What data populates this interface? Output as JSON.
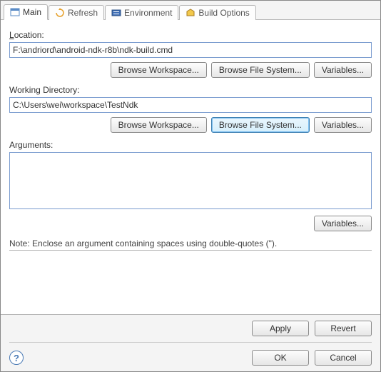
{
  "tabs": {
    "main": "Main",
    "refresh": "Refresh",
    "environment": "Environment",
    "build_options": "Build Options"
  },
  "location": {
    "label": "Location:",
    "value": "F:\\andriord\\android-ndk-r8b\\ndk-build.cmd",
    "browse_workspace": "Browse Workspace...",
    "browse_filesystem": "Browse File System...",
    "variables": "Variables..."
  },
  "working_dir": {
    "label": "Working Directory:",
    "value": "C:\\Users\\wei\\workspace\\TestNdk",
    "browse_workspace": "Browse Workspace...",
    "browse_filesystem": "Browse File System...",
    "variables": "Variables..."
  },
  "arguments": {
    "label": "Arguments:",
    "value": "",
    "variables": "Variables..."
  },
  "note": "Note: Enclose an argument containing spaces using double-quotes (\").",
  "buttons": {
    "apply": "Apply",
    "revert": "Revert",
    "ok": "OK",
    "cancel": "Cancel"
  },
  "help": "?"
}
